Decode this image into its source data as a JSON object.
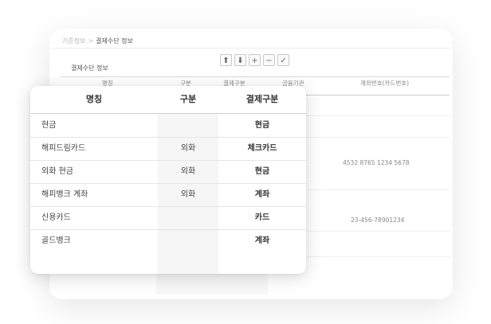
{
  "breadcrumb": {
    "prev": "기준정보",
    "separator": ">",
    "current": "결제수단 정보"
  },
  "back_panel": {
    "section_title": "결제수단 정보",
    "toolbar": [
      {
        "name": "move-up",
        "glyph": "⬆"
      },
      {
        "name": "move-down",
        "glyph": "⬇"
      },
      {
        "name": "add-row",
        "glyph": "+"
      },
      {
        "name": "remove-row",
        "glyph": "−"
      },
      {
        "name": "confirm",
        "glyph": "✓"
      }
    ],
    "columns": [
      "명칭",
      "구분",
      "결제구분",
      "금융기관",
      "계좌번호(카드번호)"
    ],
    "detail_values": [
      {
        "institution": "",
        "number": "4532 8765 1234 5678"
      },
      {
        "institution": "",
        "number": "23-456-78901234"
      }
    ]
  },
  "front_panel": {
    "columns": {
      "name": "명칭",
      "category": "구분",
      "payment_type": "결제구분"
    },
    "rows": [
      {
        "name": "현금",
        "category": "",
        "payment_type": "현금"
      },
      {
        "name": "해피드림카드",
        "category": "외화",
        "payment_type": "체크카드"
      },
      {
        "name": "외화 현금",
        "category": "외화",
        "payment_type": "현금"
      },
      {
        "name": "해피뱅크 계좌",
        "category": "외화",
        "payment_type": "계좌"
      },
      {
        "name": "신용카드",
        "category": "",
        "payment_type": "카드"
      },
      {
        "name": "골드뱅크",
        "category": "",
        "payment_type": "계좌"
      }
    ]
  }
}
